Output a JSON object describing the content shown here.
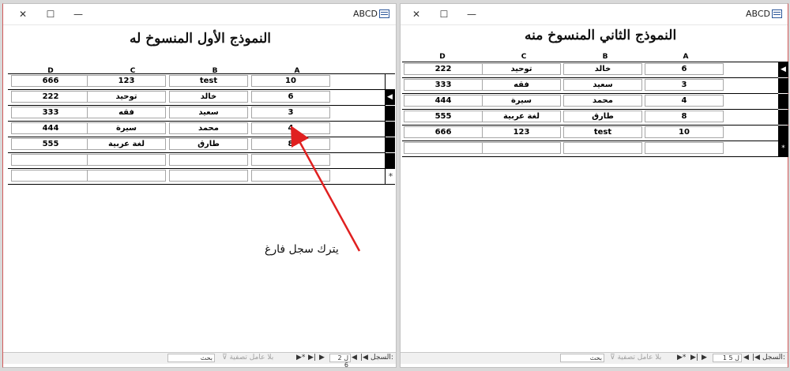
{
  "left_window": {
    "app_title": "ABCD",
    "form_title": "النموذج الأول المنسوخ له",
    "columns": [
      "D",
      "C",
      "B",
      "A"
    ],
    "rows": [
      [
        "666",
        "123",
        "test",
        "10"
      ],
      [
        "222",
        "توحيد",
        "خالد",
        "6"
      ],
      [
        "333",
        "فقه",
        "سعيد",
        "3"
      ],
      [
        "444",
        "سيرة",
        "محمد",
        "4"
      ],
      [
        "555",
        "لغة عربية",
        "طارق",
        "8"
      ],
      [
        "",
        "",
        "",
        ""
      ],
      [
        "",
        "",
        "",
        ""
      ]
    ],
    "status": {
      "record_label": "السجل:",
      "record_position": "2 ل 6",
      "filter_label": "بلا عامل تصفية",
      "search_label": "بحث"
    }
  },
  "right_window": {
    "app_title": "ABCD",
    "form_title": "النموذج الثاني المنسوخ منه",
    "columns": [
      "D",
      "C",
      "B",
      "A"
    ],
    "rows": [
      [
        "222",
        "توحيد",
        "خالد",
        "6"
      ],
      [
        "333",
        "فقه",
        "سعيد",
        "3"
      ],
      [
        "444",
        "سيرة",
        "محمد",
        "4"
      ],
      [
        "555",
        "لغة عربية",
        "طارق",
        "8"
      ],
      [
        "666",
        "123",
        "test",
        "10"
      ],
      [
        "",
        "",
        "",
        ""
      ]
    ],
    "status": {
      "record_label": "السجل:",
      "record_position": "1 ل 5",
      "filter_label": "بلا عامل تصفية",
      "search_label": "بحث"
    }
  },
  "window_controls": {
    "close": "✕",
    "maximize": "☐",
    "minimize": "—"
  },
  "annotation": {
    "text": "يترك سجل فارغ",
    "color": "#e02020"
  },
  "icons": {
    "current_record": "triangle-left-icon",
    "new_record": "asterisk-icon"
  }
}
